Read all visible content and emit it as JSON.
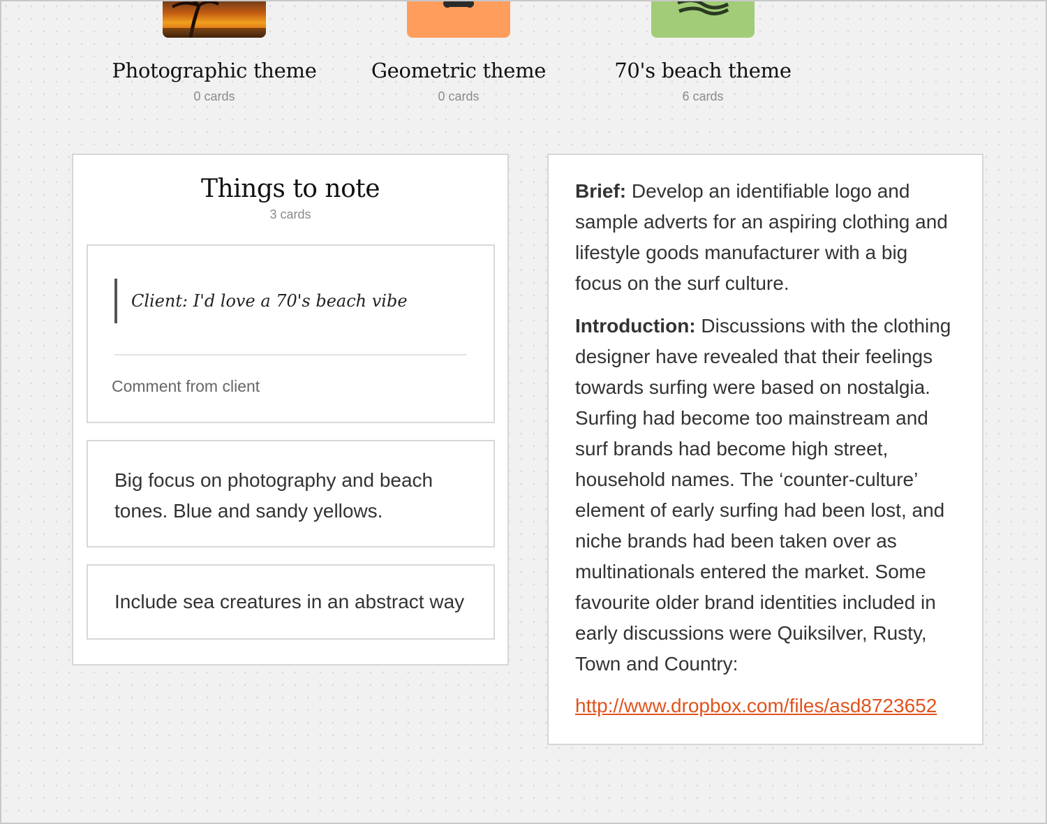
{
  "boards": [
    {
      "title": "Photographic theme",
      "count": "0 cards",
      "thumb_color": "#e88a1a",
      "icon": "sunset-palm-photo"
    },
    {
      "title": "Geometric theme",
      "count": "0 cards",
      "thumb_color": "#ff9d5c",
      "icon": "geometric-icon"
    },
    {
      "title": "70's beach theme",
      "count": "6 cards",
      "thumb_color": "#a2cc78",
      "icon": "wave-icon"
    }
  ],
  "notes": {
    "title": "Things to note",
    "count": "3 cards",
    "cards": [
      {
        "quote": "Client: I'd love a 70's beach vibe",
        "caption": "Comment from client"
      },
      {
        "text": "Big focus on photography and beach tones. Blue and sandy yellows."
      },
      {
        "text": "Include sea creatures in an abstract way"
      }
    ]
  },
  "brief": {
    "brief_label": "Brief:",
    "brief_text": " Develop an identifiable logo and sample adverts for an aspiring clothing and lifestyle goods manufacturer with a big focus on the surf culture.",
    "intro_label": "Introduction:",
    "intro_text": " Discussions with the clothing designer have revealed that their feelings towards surfing were based on nostalgia. Surfing had become too mainstream and surf brands had become high street, household names. The ‘counter-culture’ element of early surfing had been lost, and niche brands had been taken over as multinationals entered the market. Some favourite older brand identities included in early discussions were Quiksilver, Rusty, Town and Country:",
    "link": "http://www.dropbox.com/files/asd8723652"
  },
  "colors": {
    "accent_link": "#e0531e",
    "background": "#f1f1f1"
  }
}
